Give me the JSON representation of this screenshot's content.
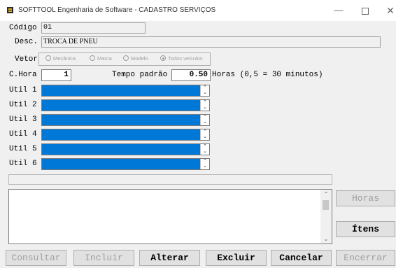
{
  "window": {
    "title": "SOFTTOOL Engenharia de Software - CADASTRO SERVIÇOS",
    "controls": {
      "minimize": "—",
      "close": "✕"
    }
  },
  "form": {
    "codigo_label": "Código",
    "codigo_value": "01",
    "desc_label": "Desc.",
    "desc_value": "TROCA DE PNEU",
    "vetor_label": "Vetor",
    "vetor_options": [
      "Mecânica",
      "Marca",
      "Modelo",
      "Todos veículos"
    ],
    "vetor_selected": "Todos veículos",
    "chora_label": "C.Hora",
    "chora_value": "1",
    "tempo_label": "Tempo padrão",
    "tempo_value": "0.50",
    "horas_note": "Horas (0,5 = 30 minutos)",
    "util_labels": [
      "Util 1",
      "Util 2",
      "Util 3",
      "Util 4",
      "Util 5",
      "Util 6"
    ]
  },
  "side_buttons": {
    "horas": "Horas",
    "itens": "Ítens"
  },
  "bottom_buttons": {
    "consultar": "Consultar",
    "incluir": "Incluir",
    "alterar": "Alterar",
    "excluir": "Excluir",
    "cancelar": "Cancelar",
    "encerrar": "Encerrar"
  },
  "colors": {
    "selection": "#0078d7",
    "background": "#f0f0f0"
  }
}
